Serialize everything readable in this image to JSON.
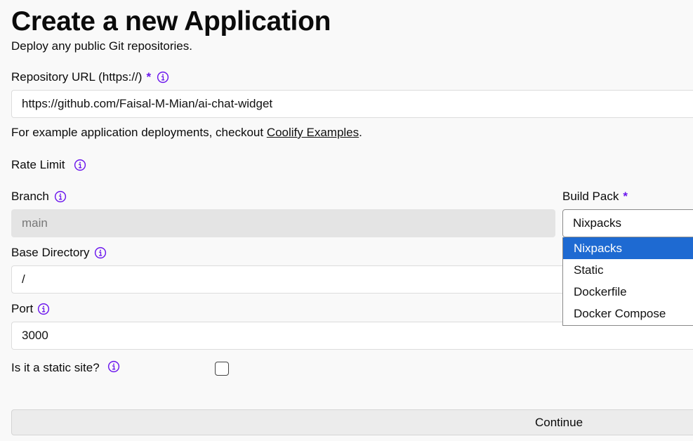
{
  "header": {
    "title": "Create a new Application",
    "subtitle": "Deploy any public Git repositories."
  },
  "repository": {
    "label": "Repository URL (https://)",
    "required_mark": "*",
    "value": "https://github.com/Faisal-M-Mian/ai-chat-widget"
  },
  "helper": {
    "prefix": "For example application deployments, checkout ",
    "link": "Coolify Examples",
    "suffix": "."
  },
  "rate_limit": {
    "label": "Rate Limit"
  },
  "branch": {
    "label": "Branch",
    "value": "main"
  },
  "build_pack": {
    "label": "Build Pack",
    "required_mark": "*",
    "selected": "Nixpacks",
    "options": [
      "Nixpacks",
      "Static",
      "Dockerfile",
      "Docker Compose"
    ]
  },
  "base_directory": {
    "label": "Base Directory",
    "value": "/"
  },
  "port": {
    "label": "Port",
    "value": "3000"
  },
  "static_site": {
    "label": "Is it a static site?",
    "checked": false
  },
  "actions": {
    "continue_label": "Continue"
  },
  "colors": {
    "accent": "#6b16ed",
    "selected_option": "#1e6ad2",
    "disabled_field": "#e4e4e4"
  },
  "icons": {
    "info": "info-circle-icon"
  }
}
